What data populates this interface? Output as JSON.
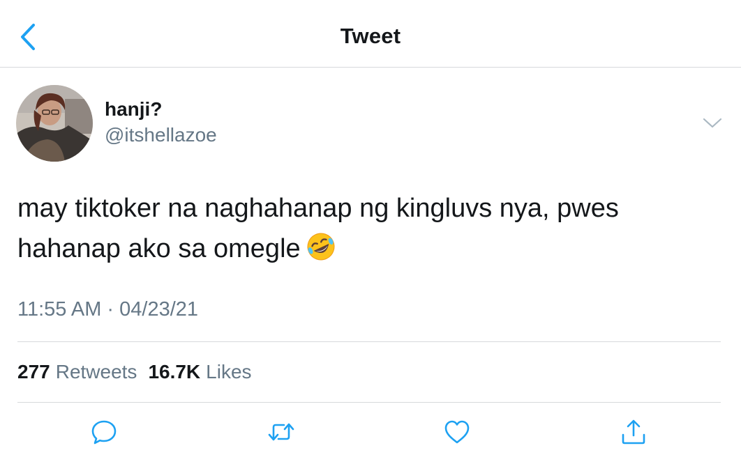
{
  "header": {
    "title": "Tweet",
    "back_icon": "chevron-left-icon"
  },
  "author": {
    "display_name": "hanji?",
    "handle": "@itshellazoe"
  },
  "tweet": {
    "text_line_1": "may tiktoker na naghahanap ng kingluvs nya, pwes",
    "text_line_2": "hahanap ako sa omegle",
    "emoji": "rolling-on-floor-laughing-emoji",
    "timestamp": "11:55 AM · 04/23/21"
  },
  "stats": {
    "retweets_count": "277",
    "retweets_label": "Retweets",
    "likes_count": "16.7K",
    "likes_label": "Likes"
  },
  "actions": [
    {
      "icon": "reply-icon"
    },
    {
      "icon": "retweet-icon"
    },
    {
      "icon": "like-icon"
    },
    {
      "icon": "share-icon"
    }
  ],
  "colors": {
    "accent": "#1da1f2",
    "secondary_text": "#657786",
    "primary_text": "#14171a",
    "divider": "#d6d9db"
  }
}
